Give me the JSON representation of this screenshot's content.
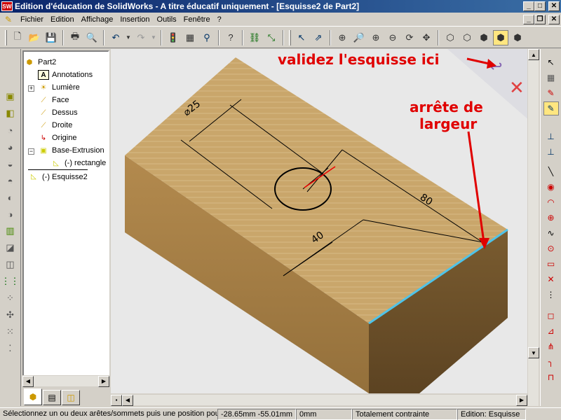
{
  "window": {
    "title": "Edition d'éducation de SolidWorks - A titre éducatif uniquement - [Esquisse2 de Part2]",
    "logo_text": "SW"
  },
  "menu": [
    "Fichier",
    "Edition",
    "Affichage",
    "Insertion",
    "Outils",
    "Fenêtre",
    "?"
  ],
  "tree": {
    "items": [
      {
        "label": "Part2",
        "icon": "part-icon"
      },
      {
        "label": "Annotations",
        "icon": "annotations-icon"
      },
      {
        "label": "Lumière",
        "icon": "lighting-icon"
      },
      {
        "label": "Face",
        "icon": "plane-icon"
      },
      {
        "label": "Dessus",
        "icon": "plane-icon"
      },
      {
        "label": "Droite",
        "icon": "plane-icon"
      },
      {
        "label": "Origine",
        "icon": "origin-icon"
      },
      {
        "label": "Base-Extrusion",
        "icon": "extrude-icon"
      },
      {
        "label": "(-) rectangle",
        "icon": "sketch-icon"
      },
      {
        "label": "(-) Esquisse2",
        "icon": "sketch-icon"
      }
    ]
  },
  "drawing": {
    "dim_diameter": "25",
    "dim_80": "80",
    "dim_40": "40"
  },
  "annotations": {
    "validate": "validez l'esquisse ici",
    "edge_line1": "arrête de",
    "edge_line2": "largeur"
  },
  "status": {
    "message": "Sélectionnez un ou deux arêtes/sommets puis une position pour",
    "coords": "-28.65mm -55.01mm",
    "z": "0mm",
    "constraint": "Totalement contrainte",
    "mode": "Edition: Esquisse"
  },
  "colors": {
    "title_bg": "#0a246a",
    "block_top": "#c9a66b",
    "block_front": "#a98146",
    "block_side": "#7a5a30",
    "edge_highlight": "#4fc3e8",
    "annotation": "#e00000"
  }
}
